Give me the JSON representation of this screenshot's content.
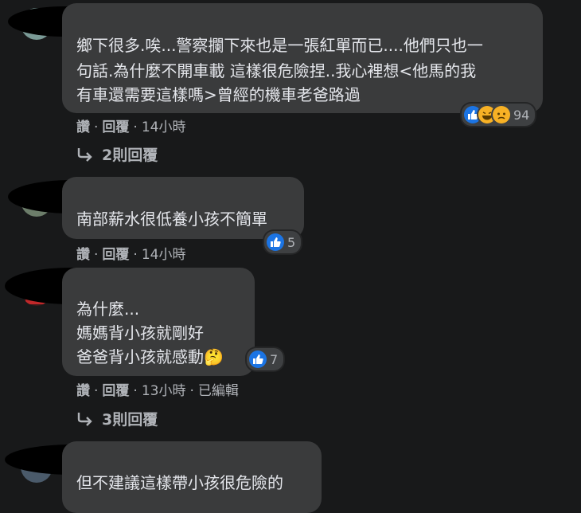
{
  "comments": [
    {
      "lines": [
        "鄉下很多.唉...警察攔下來也是一張紅單而已....他們只也一",
        "句話.為什麼不開車載 這樣很危險捏..我心裡想<他馬的我",
        "有車還需要這樣嗎>曾經的機車老爸路過"
      ],
      "reaction_count": "94",
      "actions": {
        "like": "讚",
        "reply": "回覆",
        "time": "14小時"
      },
      "replies_label": "2則回覆"
    },
    {
      "lines": [
        "南部薪水很低養小孩不簡單"
      ],
      "reaction_count": "5",
      "actions": {
        "like": "讚",
        "reply": "回覆",
        "time": "14小時"
      }
    },
    {
      "lines": [
        "為什麼...",
        "媽媽背小孩就剛好",
        "爸爸背小孩就感動🤔"
      ],
      "reaction_count": "7",
      "actions": {
        "like": "讚",
        "reply": "回覆",
        "time": "13小時",
        "edited": "已編輯"
      },
      "replies_label": "3則回覆"
    },
    {
      "lines": [
        "但不建議這樣帶小孩很危險的"
      ]
    }
  ],
  "icons": {
    "like": "thumbs-up-icon",
    "haha": "laughing-face-icon",
    "sad": "sad-face-icon",
    "reply_arrow": "reply-arrow-icon"
  },
  "colors": {
    "background": "#18191a",
    "bubble": "#3a3b3c",
    "like_blue": "#1b74e4",
    "emoji_yellow": "#f7b125"
  }
}
